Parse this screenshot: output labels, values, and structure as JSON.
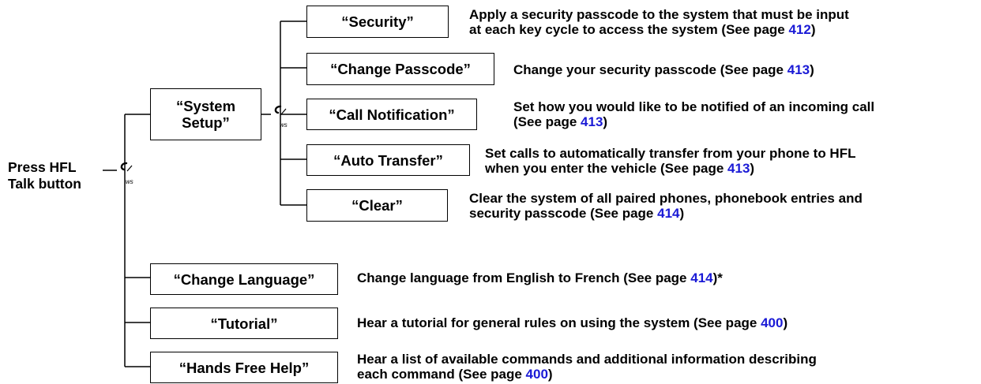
{
  "root": {
    "label": "Press HFL\nTalk button"
  },
  "system_setup": {
    "label": "“System\nSetup”"
  },
  "commands": [
    {
      "id": "security",
      "label": "“Security”",
      "desc_lines": [
        {
          "text": "Apply a security passcode to the system that must be input"
        },
        {
          "text": "at each key cycle to access the system (See page ",
          "page": "412",
          "after": ")"
        }
      ]
    },
    {
      "id": "change-passcode",
      "label": "“Change Passcode”",
      "desc_lines": [
        {
          "text": "Change your security passcode (See page ",
          "page": "413",
          "after": ")"
        }
      ]
    },
    {
      "id": "call-notification",
      "label": "“Call Notification”",
      "desc_lines": [
        {
          "text": "Set how you would like to be notified of an incoming call"
        },
        {
          "text": "(See page ",
          "page": "413",
          "after": ")"
        }
      ]
    },
    {
      "id": "auto-transfer",
      "label": "“Auto Transfer”",
      "desc_lines": [
        {
          "text": "Set calls to automatically transfer from your phone to HFL"
        },
        {
          "text": "when you enter the vehicle (See page ",
          "page": "413",
          "after": ")"
        }
      ]
    },
    {
      "id": "clear",
      "label": "“Clear”",
      "desc_lines": [
        {
          "text": "Clear the system of all paired phones, phonebook entries and"
        },
        {
          "text": "security passcode (See page ",
          "page": "414",
          "after": ")"
        }
      ]
    },
    {
      "id": "change-language",
      "label": "“Change Language”",
      "desc_lines": [
        {
          "text": "Change language from English to French (See page ",
          "page": "414",
          "after": ")*"
        }
      ]
    },
    {
      "id": "tutorial",
      "label": "“Tutorial”",
      "desc_lines": [
        {
          "text": "Hear a tutorial for general rules on using the system (See page ",
          "page": "400",
          "after": ")"
        }
      ]
    },
    {
      "id": "hands-free-help",
      "label": "“Hands Free Help”",
      "desc_lines": [
        {
          "text": "Hear a list of available commands and additional information describing"
        },
        {
          "text": "each command (See page ",
          "page": "400",
          "after": ")"
        }
      ]
    }
  ],
  "colors": {
    "page_ref": "#1a1ad6",
    "line": "#000000"
  },
  "icons": {
    "voice_command": "voice-command-icon"
  }
}
